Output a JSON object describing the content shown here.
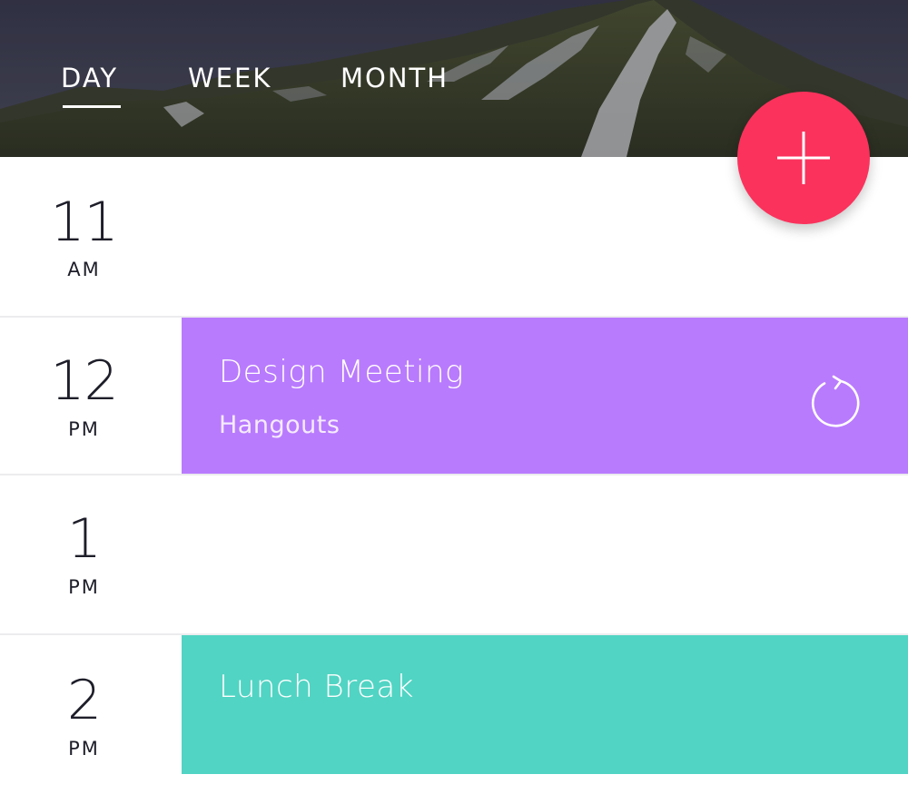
{
  "tabs": {
    "day": "DAY",
    "week": "WEEK",
    "month": "MONTH",
    "active": "DAY"
  },
  "fab": {
    "icon": "plus-icon",
    "color": "#fb325c"
  },
  "hours": [
    {
      "number": "11",
      "period": "AM"
    },
    {
      "number": "12",
      "period": "PM"
    },
    {
      "number": "1",
      "period": "PM"
    },
    {
      "number": "2",
      "period": "PM"
    }
  ],
  "events": [
    {
      "title": "Design Meeting",
      "location": "Hangouts",
      "color": "#b97bfd",
      "icon": "repeat-icon"
    },
    {
      "title": "Lunch Break",
      "color": "#51d4c3"
    }
  ]
}
